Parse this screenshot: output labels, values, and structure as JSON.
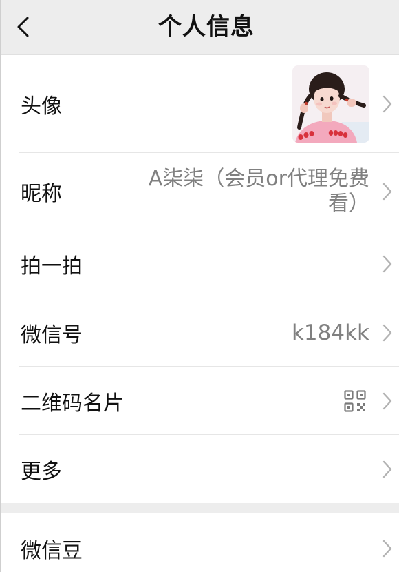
{
  "header": {
    "title": "个人信息",
    "back_icon": "chevron-left-icon"
  },
  "profile": {
    "avatar": {
      "label": "头像",
      "image": "avatar-photo"
    },
    "nickname": {
      "label": "昵称",
      "value": "A柒柒（会员or代理免费看）"
    },
    "pat": {
      "label": "拍一拍"
    },
    "wechat_id": {
      "label": "微信号",
      "value": "k184kk"
    },
    "qr_card": {
      "label": "二维码名片",
      "icon": "qr-code-icon"
    },
    "more": {
      "label": "更多"
    }
  },
  "extras": {
    "wechat_beans": {
      "label": "微信豆"
    }
  },
  "row_icon": "chevron-right-icon",
  "colors": {
    "header_bg": "#ededed",
    "text": "#111111",
    "value": "#808080",
    "chevron": "#b2b2b2",
    "divider": "#e6e6e6"
  }
}
